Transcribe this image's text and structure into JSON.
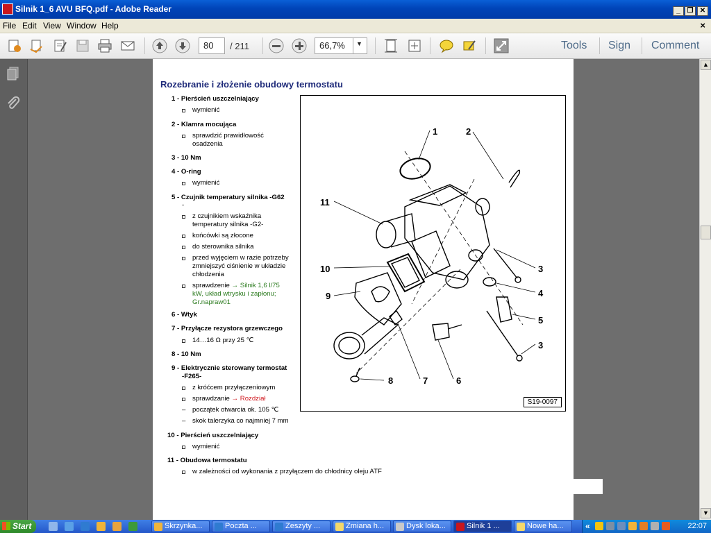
{
  "window": {
    "title": "Silnik 1_6 AVU BFQ.pdf - Adobe Reader"
  },
  "menu": [
    "File",
    "Edit",
    "View",
    "Window",
    "Help"
  ],
  "toolbar": {
    "page_number": "80",
    "page_total": "/ 211",
    "zoom": "66,7%",
    "tools_label": "Tools",
    "sign_label": "Sign",
    "comment_label": "Comment"
  },
  "document": {
    "title": "Rozebranie i złożenie obudowy termostatu",
    "items": [
      {
        "head": "1 - Pierścień uszczelniający",
        "lines": [
          "wymienić"
        ]
      },
      {
        "head": "2 - Klamra mocująca",
        "lines": [
          "sprawdzić prawidłowość osadzenia"
        ]
      },
      {
        "head": "3 - 10 Nm"
      },
      {
        "head": "4 - O-ring",
        "lines": [
          "wymienić"
        ]
      },
      {
        "head": "5 - Czujnik temperatury silnika -G62",
        "head2": "-",
        "lines": [
          "z czujnikiem wskaźnika temperatury silnika -G2-",
          "końcówki są złocone",
          "do sterownika silnika",
          "przed wyjęciem w razie potrzeby zmniejszyć ciśnienie w układzie chłodzenia"
        ],
        "link": {
          "prefix": "sprawdzenie ",
          "text": "→ Silnik 1,6 l/75 kW, układ wtrysku i zapłonu; Gr.napraw01"
        }
      },
      {
        "head": "6 - Wtyk"
      },
      {
        "head": "7 - Przyłącze rezystora grzewczego",
        "lines": [
          "14…16 Ω przy 25 ℃"
        ]
      },
      {
        "head": "8 - 10 Nm"
      },
      {
        "head": "9 - Elektrycznie sterowany termostat",
        "head2": "-F265-",
        "lines": [
          "z króćcem przyłączeniowym"
        ],
        "link": {
          "prefix": "sprawdzanie ",
          "text": "→ Rozdział"
        },
        "dashes": [
          "początek otwarcia ok. 105 ℃",
          "skok talerzyka co najmniej 7 mm"
        ]
      },
      {
        "head": "10 - Pierścień uszczelniający",
        "lines": [
          "wymienić"
        ]
      },
      {
        "head": "11 - Obudowa termostatu",
        "lines": [
          "w zależności od wykonania z przyłączem do chłodnicy oleju ATF"
        ]
      }
    ],
    "figure": {
      "code": "S19-0097",
      "callouts": [
        "1",
        "2",
        "3",
        "4",
        "5",
        "3",
        "6",
        "7",
        "8",
        "9",
        "10",
        "11"
      ]
    }
  },
  "taskbar": {
    "start_label": "Start",
    "tasks": [
      "Skrzynka...",
      "Poczta ...",
      "Zeszyty ...",
      "Zmiana h...",
      "Dysk loka...",
      "Silnik 1 ...",
      "Nowe ha..."
    ],
    "active_task_index": 5,
    "clock": "22:07",
    "chevron": "«"
  }
}
